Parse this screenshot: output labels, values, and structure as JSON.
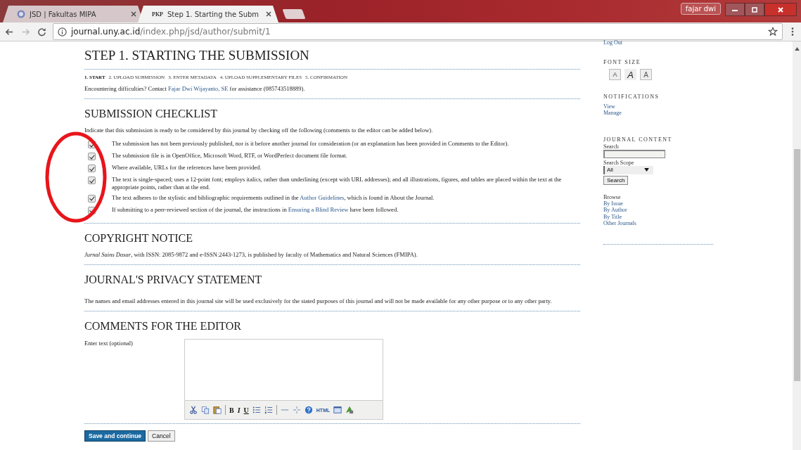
{
  "browser": {
    "tabs": [
      {
        "title": "JSD | Fakultas MIPA",
        "selected": false
      },
      {
        "title": "Step 1. Starting the Subm",
        "favicon": "PKP",
        "selected": true
      }
    ],
    "profile": "fajar dwi",
    "url_host": "journal.uny.ac.id",
    "url_path": "/index.php/jsd/author/submit/1"
  },
  "main": {
    "title": "STEP 1. STARTING THE SUBMISSION",
    "steps": [
      {
        "label": "1. START",
        "selected": true
      },
      {
        "label": "2. UPLOAD SUBMISSION",
        "selected": false
      },
      {
        "label": "3. ENTER METADATA",
        "selected": false
      },
      {
        "label": "4. UPLOAD SUPPLEMENTARY FILES",
        "selected": false
      },
      {
        "label": "5. CONFIRMATION",
        "selected": false
      }
    ],
    "help": {
      "before": "Encountering difficulties? Contact ",
      "link": "Fajar Dwi Wijayanto, SE",
      "after": " for assistance (085743518889)."
    },
    "checklist": {
      "title": "SUBMISSION CHECKLIST",
      "intro": "Indicate that this submission is ready to be considered by this journal by checking off the following (comments to the editor can be added below).",
      "items": [
        {
          "checked": true,
          "before": "The submission has not been previously published, nor is it before another journal for consideration (or an explanation has been provided in Comments to the Editor)."
        },
        {
          "checked": true,
          "before": "The submission file is in OpenOffice, Microsoft Word, RTF, or WordPerfect document file format."
        },
        {
          "checked": true,
          "before": "Where available, URLs for the references have been provided."
        },
        {
          "checked": true,
          "before": "The text is single-spaced; uses a 12-point font; employs italics, rather than underlining (except with URL addresses); and all illustrations, figures, and tables are placed within the text at the appropriate points, rather than at the end."
        },
        {
          "checked": true,
          "before": "The text adheres to the stylistic and bibliographic requirements outlined in the ",
          "link": "Author Guidelines",
          "after": ", which is found in About the Journal."
        },
        {
          "checked": true,
          "before": "If submitting to a peer-reviewed section of the journal, the instructions in ",
          "link": "Ensuring a Blind Review",
          "after": " have been followed."
        }
      ]
    },
    "copyright": {
      "title": "COPYRIGHT NOTICE",
      "text": "*Jurnal Sains Dasar*, with ISSN: 2085-9872 and e-ISSN:2443-1273, is published by faculty of Mathematics and Natural Sciences (FMIPA)."
    },
    "privacy": {
      "title": "JOURNAL'S PRIVACY STATEMENT",
      "text": "The names and email addresses entered in this journal site will be used exclusively for the stated purposes of this journal and will not be made available for any other purpose or to any other party."
    },
    "comments": {
      "title": "COMMENTS FOR THE EDITOR",
      "label": "Enter text (optional)",
      "toolbar": [
        {
          "kind": "cut"
        },
        {
          "kind": "copy"
        },
        {
          "kind": "paste"
        },
        {
          "kind": "sep"
        },
        {
          "kind": "bold",
          "label": "B"
        },
        {
          "kind": "italic",
          "label": "I"
        },
        {
          "kind": "underline",
          "label": "U"
        },
        {
          "kind": "bullets"
        },
        {
          "kind": "numbers"
        },
        {
          "kind": "sep"
        },
        {
          "kind": "link",
          "disabled": true
        },
        {
          "kind": "unlink",
          "disabled": true
        },
        {
          "kind": "help"
        },
        {
          "kind": "html",
          "label": "HTML"
        },
        {
          "kind": "fullscreen"
        },
        {
          "kind": "image"
        }
      ]
    },
    "buttons": {
      "save": "Save and continue",
      "cancel": "Cancel"
    }
  },
  "sidebar": {
    "logout": "Log Out",
    "font_size_title": "FONT SIZE",
    "font_sizes": [
      {
        "kind": "small",
        "label": "A"
      },
      {
        "kind": "medium",
        "label": "A"
      },
      {
        "kind": "large",
        "label": "A"
      }
    ],
    "notifications_title": "NOTIFICATIONS",
    "notifications": [
      "View",
      "Manage"
    ],
    "content_title": "JOURNAL CONTENT",
    "search_label": "Search",
    "scope_label": "Search Scope",
    "scope_value": "All",
    "search_button": "Search",
    "browse_label": "Browse",
    "browse": [
      "By Issue",
      "By Author",
      "By Title",
      "Other Journals"
    ]
  }
}
